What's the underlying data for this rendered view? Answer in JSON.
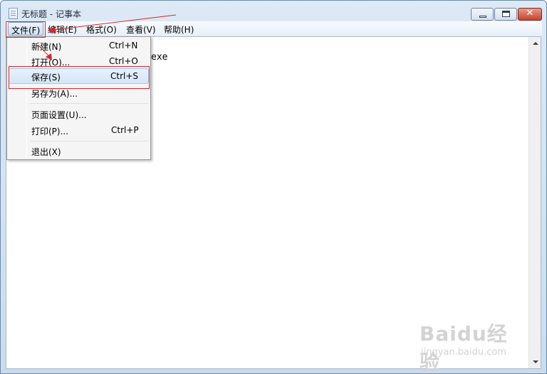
{
  "window": {
    "title": "无标题 - 记事本",
    "icon": "notepad-icon",
    "controls": {
      "minimize_icon": "minimize-icon",
      "maximize_icon": "maximize-icon",
      "close_icon": "close-icon",
      "close_glyph": "✕"
    }
  },
  "menubar": {
    "items": [
      {
        "label": "文件(F)"
      },
      {
        "label": "编辑(E)"
      },
      {
        "label": "格式(O)"
      },
      {
        "label": "查看(V)"
      },
      {
        "label": "帮助(H)"
      }
    ]
  },
  "file_menu": {
    "items": [
      {
        "label": "新建(N)",
        "shortcut": "Ctrl+N"
      },
      {
        "label": "打开(O)...",
        "shortcut": "Ctrl+O"
      },
      {
        "label": "保存(S)",
        "shortcut": "Ctrl+S"
      },
      {
        "label": "另存为(A)...",
        "shortcut": ""
      },
      {
        "label": "页面设置(U)...",
        "shortcut": ""
      },
      {
        "label": "打印(P)...",
        "shortcut": "Ctrl+P"
      },
      {
        "label": "退出(X)",
        "shortcut": ""
      }
    ],
    "highlighted": "保存(S)"
  },
  "editor": {
    "visible_text": "exe"
  },
  "annotation": {
    "color": "#d8262c"
  },
  "watermark": {
    "logo": "Baidu经验",
    "url": "jingyan.baidu.com"
  },
  "colors": {
    "accent": "#d8262c",
    "menu_hover_border": "#a7c9ee",
    "title_gradient_top": "#dde9f5"
  }
}
